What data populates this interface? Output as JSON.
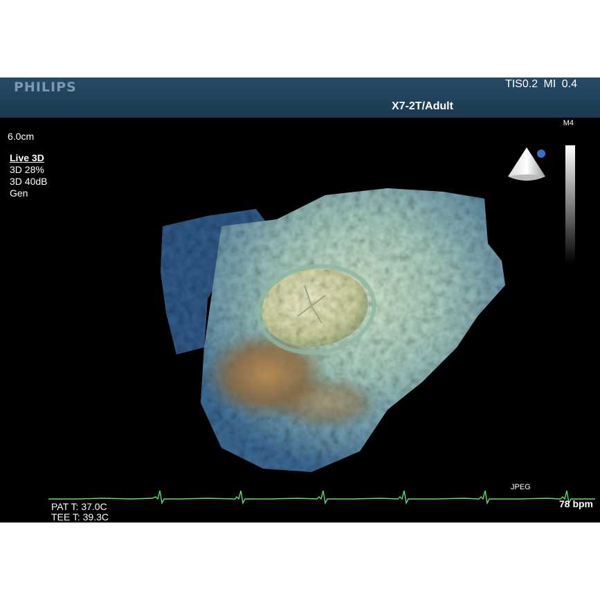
{
  "header": {
    "brand": "PHILIPS",
    "indices": "TIS0.2   MI 0.4",
    "probe": "X7-2T/Adult"
  },
  "settings": {
    "depth": "6.0cm",
    "mode": "Live 3D",
    "percent": "3D 28%",
    "gain": "3D 40dB",
    "gen": "Gen"
  },
  "map": {
    "name": "M4"
  },
  "footer": {
    "format": "JPEG",
    "pat_temp": "PAT T: 37.0C",
    "tee_temp": "TEE T: 39.3C",
    "heart_rate": "78 bpm"
  },
  "colors": {
    "header_bg": "#1f4059",
    "brand": "#7e97b3",
    "ecg": "#5fe06a",
    "tissue_light": "#c9e6c6",
    "tissue_blue": "#3d6d9c",
    "tissue_brown": "#9a6b3b"
  },
  "icons": [
    "probe-orientation-icon"
  ]
}
